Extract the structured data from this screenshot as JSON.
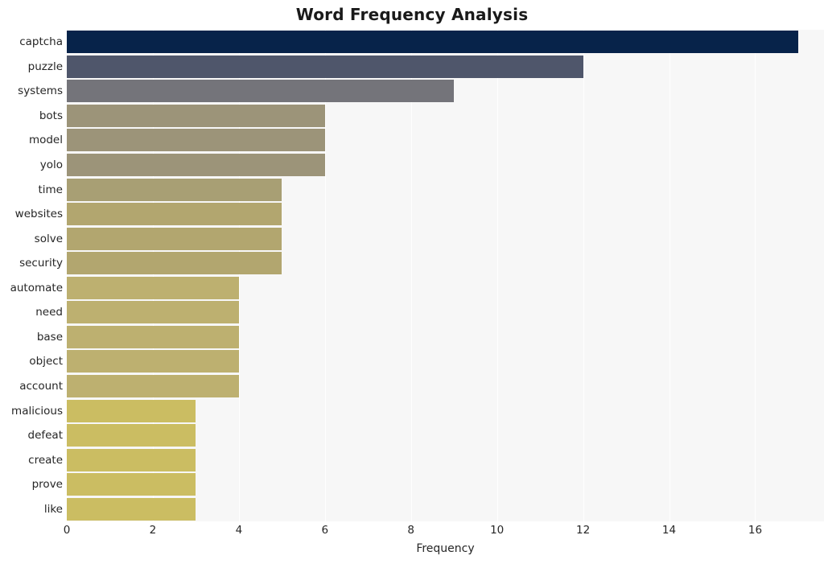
{
  "chart_data": {
    "type": "bar",
    "orientation": "horizontal",
    "title": "Word Frequency Analysis",
    "xlabel": "Frequency",
    "ylabel": "",
    "xlim": [
      0,
      17.6
    ],
    "ylim": [
      0,
      20
    ],
    "grid": true,
    "legend": null,
    "x_ticks": [
      0,
      2,
      4,
      6,
      8,
      10,
      12,
      14,
      16
    ],
    "x_tick_labels": [
      "0",
      "2",
      "4",
      "6",
      "8",
      "10",
      "12",
      "14",
      "16"
    ],
    "categories": [
      "captcha",
      "puzzle",
      "systems",
      "bots",
      "model",
      "yolo",
      "time",
      "websites",
      "solve",
      "security",
      "automate",
      "need",
      "base",
      "object",
      "account",
      "malicious",
      "defeat",
      "create",
      "prove",
      "like"
    ],
    "values": [
      17,
      12,
      9,
      6,
      6,
      6,
      5,
      5,
      5,
      5,
      4,
      4,
      4,
      4,
      4,
      3,
      3,
      3,
      3,
      3
    ],
    "bar_colors": [
      "#07234a",
      "#4f566b",
      "#74747a",
      "#9c9479",
      "#9c9479",
      "#9c9479",
      "#ada munde",
      "#b2a66f",
      "#b2a66f",
      "#b2a66f",
      "#bdb070",
      "#bdb070",
      "#bdb070",
      "#bdb070",
      "#bdb070",
      "#cbbd62",
      "#cbbd62",
      "#cbbd62",
      "#cbbd62",
      "#cbbd62"
    ],
    "plot_background": "#f7f7f7",
    "figure_background": "#ffffff"
  }
}
